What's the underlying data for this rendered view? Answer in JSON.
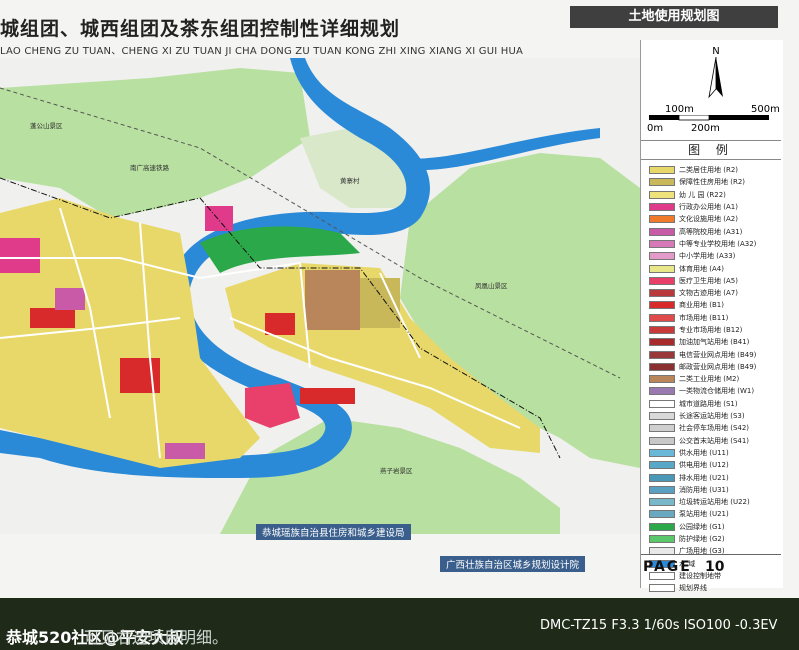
{
  "board": {
    "title": "城组团、城西组团及茶东组团控制性详细规划",
    "subtitle": "LAO CHENG ZU TUAN、CHENG XI ZU TUAN JI CHA DONG ZU TUAN KONG ZHI XING XIANG XI GUI HUA",
    "banner": "土地使用规划图"
  },
  "map_labels": {
    "hill1": "蓬公山景区",
    "rail": "南广高速铁路",
    "village": "黄寨村",
    "hill2": "凤凰山景区",
    "hill3": "燕子岩景区"
  },
  "legend": {
    "north": "N",
    "scale_top": [
      "100m",
      "500m"
    ],
    "scale_bottom": [
      "0m",
      "200m"
    ],
    "title": "图 例",
    "items": [
      {
        "label": "二类居住用地 (R2)",
        "color": "#e8d86a"
      },
      {
        "label": "保障性住房用地 (R2)",
        "color": "#c9b85a"
      },
      {
        "label": "幼 儿 园 (R22)",
        "color": "#f0e27a"
      },
      {
        "label": "行政办公用地 (A1)",
        "color": "#e03a8a"
      },
      {
        "label": "文化设施用地 (A2)",
        "color": "#f07a2a"
      },
      {
        "label": "高等院校用地 (A31)",
        "color": "#c85aa8"
      },
      {
        "label": "中等专业学校用地 (A32)",
        "color": "#d778b8"
      },
      {
        "label": "中小学用地 (A33)",
        "color": "#e39ac8"
      },
      {
        "label": "体育用地 (A4)",
        "color": "#e8e88a"
      },
      {
        "label": "医疗卫生用地 (A5)",
        "color": "#e8406a"
      },
      {
        "label": "文物古迹用地 (A7)",
        "color": "#b83a3a"
      },
      {
        "label": "商业用地 (B1)",
        "color": "#d82a2a"
      },
      {
        "label": "市场用地 (B11)",
        "color": "#e04a4a"
      },
      {
        "label": "专业市场用地 (B12)",
        "color": "#c83a3a"
      },
      {
        "label": "加油加气站用地 (B41)",
        "color": "#a82a2a"
      },
      {
        "label": "电信营业网点用地 (B49)",
        "color": "#983838"
      },
      {
        "label": "邮政营业网点用地 (B49)",
        "color": "#8a3030"
      },
      {
        "label": "二类工业用地 (M2)",
        "color": "#b8865a"
      },
      {
        "label": "一类物流仓储用地 (W1)",
        "color": "#9a78b0"
      },
      {
        "label": "城市道路用地 (S1)",
        "color": "#ffffff"
      },
      {
        "label": "长途客运站用地 (S3)",
        "color": "#d8d8d8"
      },
      {
        "label": "社会停车场用地 (S42)",
        "color": "#cfcfcf"
      },
      {
        "label": "公交首末站用地 (S41)",
        "color": "#c8c8c8"
      },
      {
        "label": "供水用地 (U11)",
        "color": "#6ab8d8"
      },
      {
        "label": "供电用地 (U12)",
        "color": "#5aa8c8"
      },
      {
        "label": "排水用地 (U21)",
        "color": "#4a98b8"
      },
      {
        "label": "消防用地 (U31)",
        "color": "#5aa0c0"
      },
      {
        "label": "垃圾转运站用地 (U22)",
        "color": "#78b8c8"
      },
      {
        "label": "泵站用地 (U21)",
        "color": "#68a8c0"
      },
      {
        "label": "公园绿地 (G1)",
        "color": "#2aa84a"
      },
      {
        "label": "防护绿地 (G2)",
        "color": "#5ac86a"
      },
      {
        "label": "广场用地 (G3)",
        "color": "#e8e8e8"
      },
      {
        "label": "水 域",
        "color": "#2a8ad8"
      },
      {
        "label": "建设控制地带",
        "color": "#ffffff"
      },
      {
        "label": "规划界线",
        "color": "#ffffff"
      }
    ],
    "page_label": "PAGE",
    "page_number": "10"
  },
  "footer": {
    "org1": "恭城瑶族自治县住房和城乡建设局",
    "org2": "广西壮族自治区城乡规划设计院"
  },
  "photo_overlay": {
    "watermark": "恭城520社区@平安大叔",
    "caption": "可见右边项目明细。",
    "exif": "DMC-TZ15 F3.3 1/60s ISO100 -0.3EV"
  }
}
